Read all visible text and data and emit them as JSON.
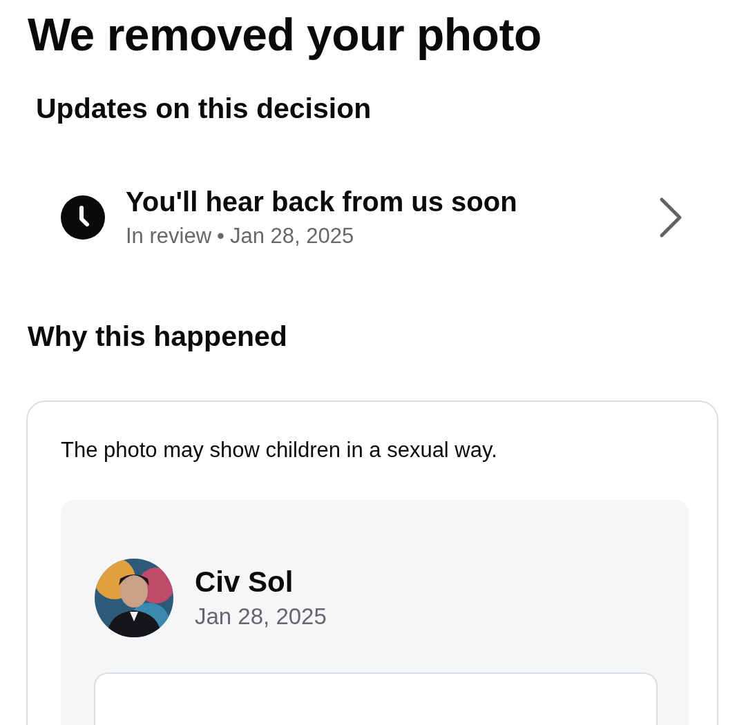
{
  "title": "We removed your photo",
  "updates": {
    "heading": "Updates on this decision",
    "item": {
      "title": "You'll hear back from us soon",
      "status": "In review",
      "separator": "•",
      "date": "Jan 28, 2025"
    }
  },
  "reason": {
    "heading": "Why this happened",
    "text": "The photo may show children in a sexual way.",
    "post": {
      "author": "Civ Sol",
      "date": "Jan 28, 2025"
    }
  }
}
